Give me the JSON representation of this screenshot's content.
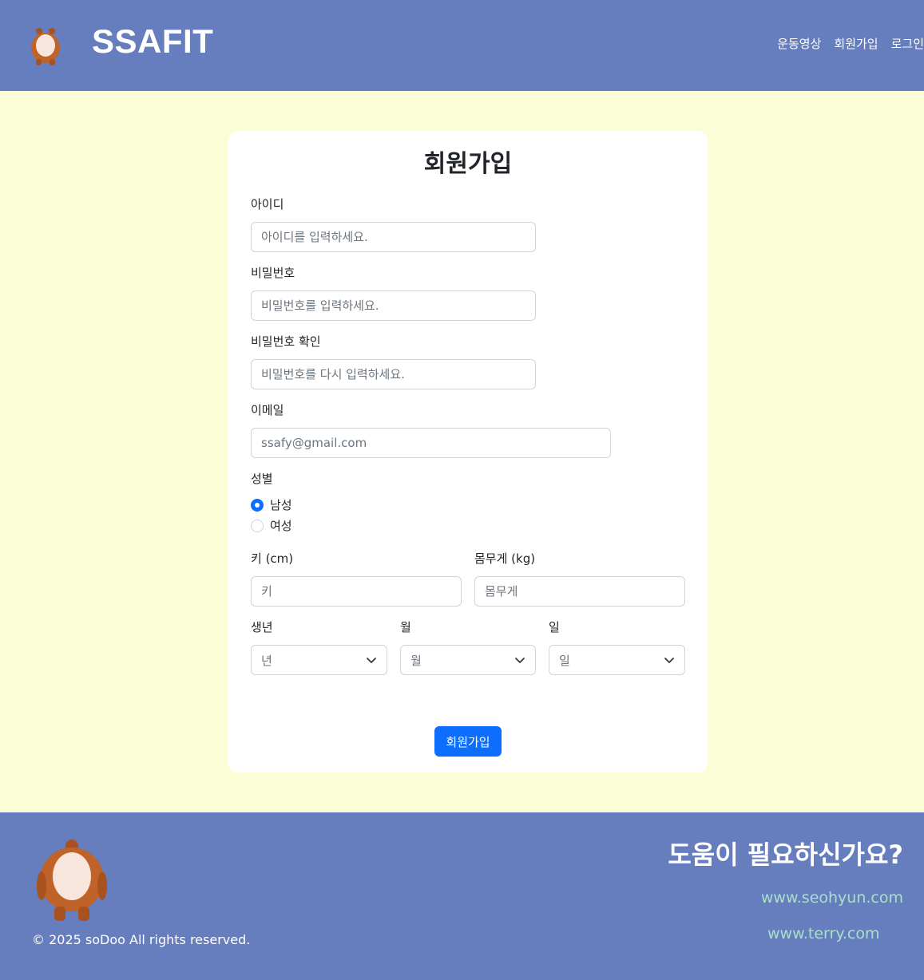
{
  "header": {
    "brand": "SSAFIT",
    "nav": [
      "운동영상",
      "회원가입",
      "로그인"
    ]
  },
  "form": {
    "title": "회원가입",
    "id_label": "아이디",
    "id_placeholder": "아이디를 입력하세요.",
    "pw_label": "비밀번호",
    "pw_placeholder": "비밀번호를 입력하세요.",
    "pw_confirm_label": "비밀번호 확인",
    "pw_confirm_placeholder": "비밀번호를 다시 입력하세요.",
    "email_label": "이메일",
    "email_placeholder": "ssafy@gmail.com",
    "gender_label": "성별",
    "gender_options": [
      "남성",
      "여성"
    ],
    "gender_selected": "남성",
    "height_label": "키 (cm)",
    "height_placeholder": "키",
    "weight_label": "몸무게 (kg)",
    "weight_placeholder": "몸무게",
    "year_label": "생년",
    "year_value": "년",
    "month_label": "월",
    "month_value": "월",
    "day_label": "일",
    "day_value": "일",
    "submit_label": "회원가입"
  },
  "footer": {
    "copyright": "© 2025 soDoo All rights reserved.",
    "help_title": "도움이 필요하신가요?",
    "links": [
      "www.seohyun.com",
      "www.terry.com"
    ]
  },
  "colors": {
    "header_bg": "#667ebd",
    "page_bg": "#fbfdd6",
    "primary": "#0d6efd",
    "link": "#a8e0c8"
  }
}
